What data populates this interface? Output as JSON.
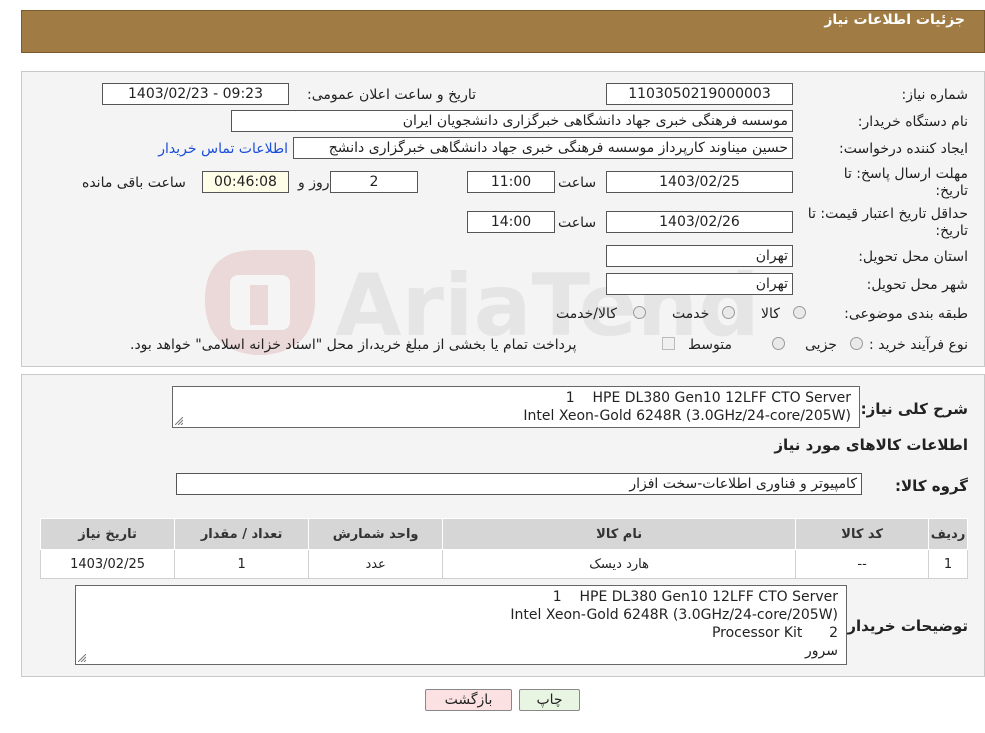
{
  "header": {
    "title": "جزئیات اطلاعات نیاز"
  },
  "fields": {
    "need_number": {
      "label": "شماره نیاز:",
      "value": "1103050219000003"
    },
    "announce_datetime": {
      "label": "تاریخ و ساعت اعلان عمومی:",
      "value": "1403/02/23 - 09:23"
    },
    "buyer_org": {
      "label": "نام دستگاه خریدار:",
      "value": "موسسه فرهنگی خبری جهاد دانشگاهی خبرگزاری دانشجویان ایران"
    },
    "requester": {
      "label": "ایجاد کننده درخواست:",
      "value": "حسین میناوند کارپرداز موسسه فرهنگی خبری جهاد دانشگاهی خبرگزاری دانشج"
    },
    "buyer_contact_link": "اطلاعات تماس خریدار",
    "reply_deadline": {
      "label": "مهلت ارسال پاسخ: تا تاریخ:",
      "date": "1403/02/25",
      "time_label": "ساعت",
      "time": "11:00",
      "days": "2",
      "days_label": "روز و",
      "remaining": "00:46:08",
      "remaining_label": "ساعت باقی مانده"
    },
    "price_validity": {
      "label": "حداقل تاریخ اعتبار قیمت: تا تاریخ:",
      "date": "1403/02/26",
      "time_label": "ساعت",
      "time": "14:00"
    },
    "delivery_province": {
      "label": "استان محل تحویل:",
      "value": "تهران"
    },
    "delivery_city": {
      "label": "شهر محل تحویل:",
      "value": "تهران"
    },
    "category": {
      "label": "طبقه بندی موضوعی:",
      "options": [
        "کالا",
        "خدمت",
        "کالا/خدمت"
      ]
    },
    "purchase_type": {
      "label": "نوع فرآیند خرید :",
      "options": [
        "جزیی",
        "متوسط"
      ],
      "note": "پرداخت تمام یا بخشی از مبلغ خرید،از محل \"اسناد خزانه اسلامی\" خواهد بود."
    }
  },
  "summary": {
    "label": "شرح کلی نیاز:",
    "lines": [
      "1    HPE DL380 Gen10 12LFF CTO Server",
      "Intel Xeon-Gold 6248R (3.0GHz/24-core/205W)"
    ]
  },
  "goods_info_title": "اطلاعات کالاهای مورد نیاز",
  "goods_group": {
    "label": "گروه کالا:",
    "value": "کامپیوتر و فناوری اطلاعات-سخت افزار"
  },
  "table": {
    "headers": [
      "ردیف",
      "کد کالا",
      "نام کالا",
      "واحد شمارش",
      "تعداد / مقدار",
      "تاریخ نیاز"
    ],
    "rows": [
      [
        "1",
        "--",
        "هارد دیسک",
        "عدد",
        "1",
        "1403/02/25"
      ]
    ]
  },
  "buyer_notes": {
    "label": "توضیحات خریدار:",
    "lines": [
      "1    HPE DL380 Gen10 12LFF CTO Server",
      "Intel Xeon-Gold 6248R (3.0GHz/24-core/205W)",
      "Processor Kit      2",
      "سرور"
    ]
  },
  "buttons": {
    "print": "چاپ",
    "back": "بازگشت"
  },
  "watermark": "AriaTender.neT"
}
